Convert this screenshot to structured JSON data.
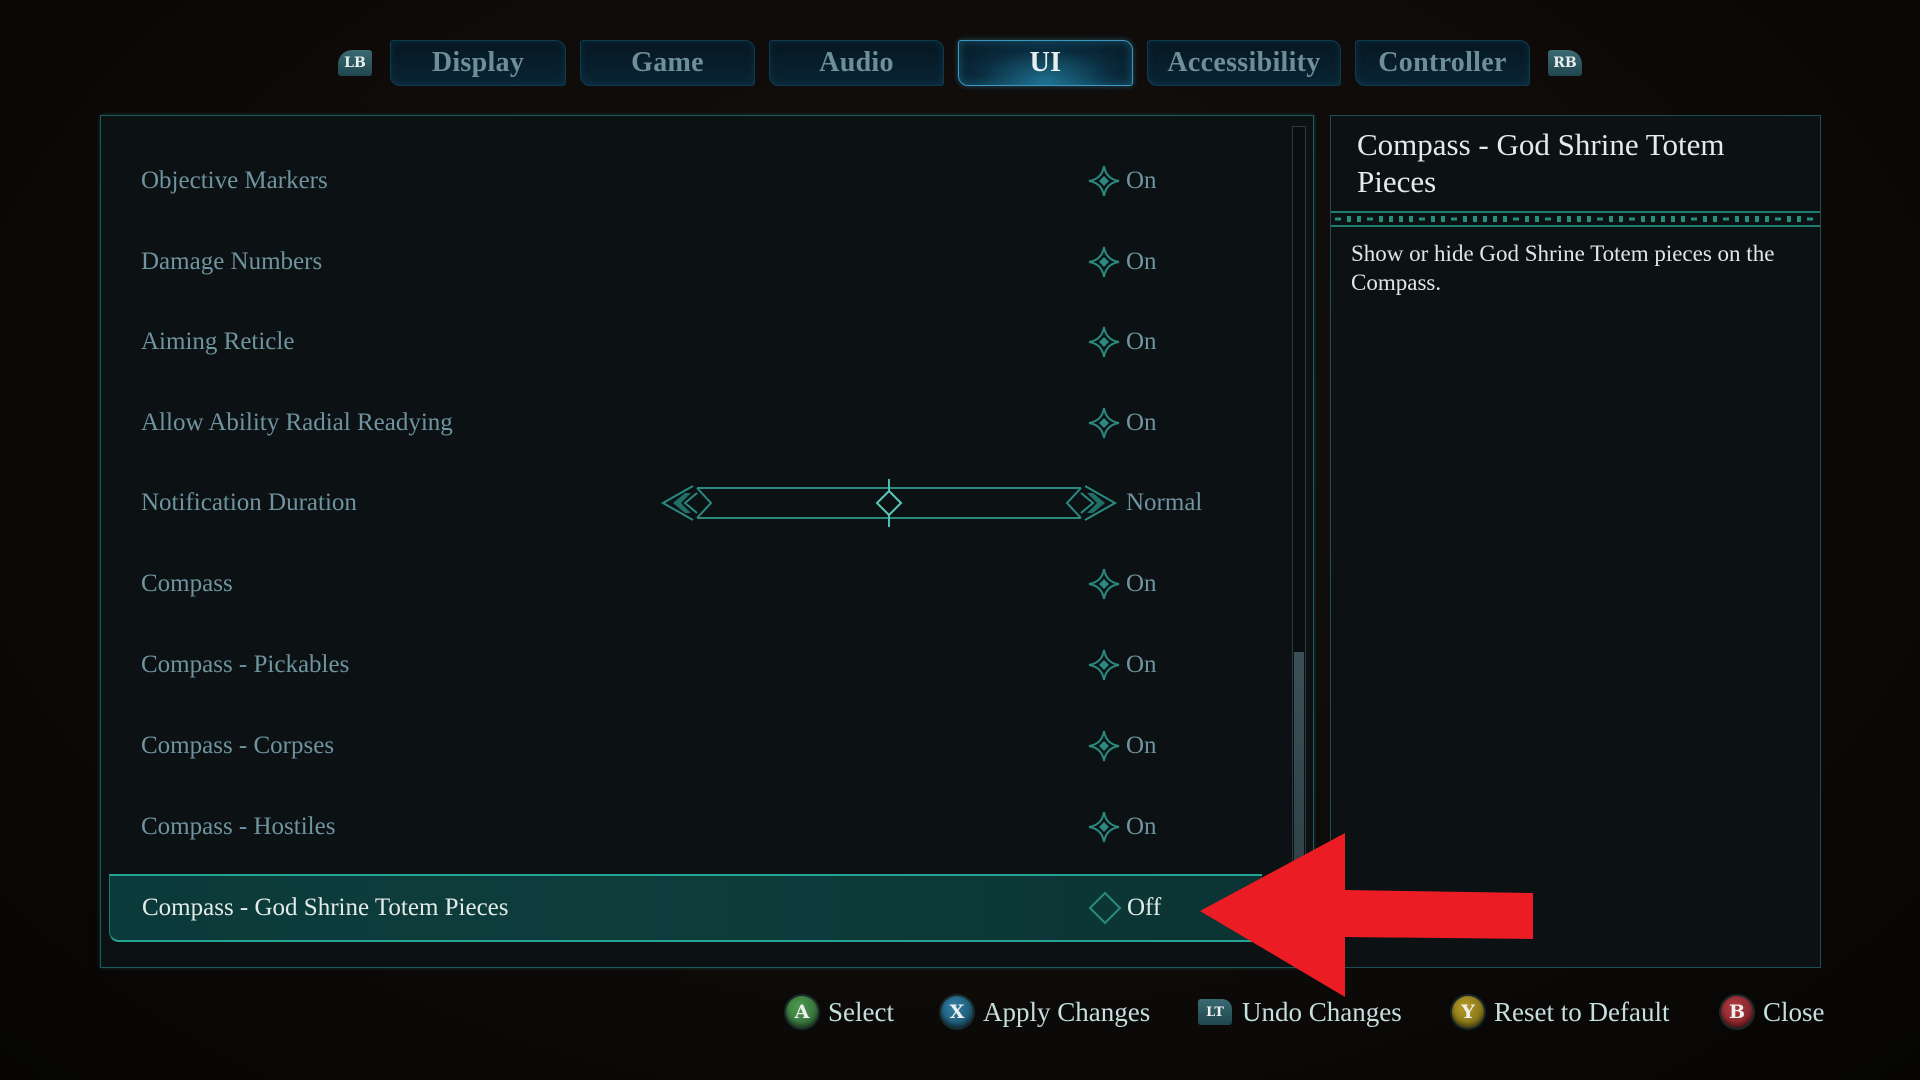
{
  "tabs": {
    "prev_bumper": "LB",
    "next_bumper": "RB",
    "items": [
      {
        "label": "Display",
        "active": false
      },
      {
        "label": "Game",
        "active": false
      },
      {
        "label": "Audio",
        "active": false
      },
      {
        "label": "UI",
        "active": true
      },
      {
        "label": "Accessibility",
        "active": false
      },
      {
        "label": "Controller",
        "active": false
      }
    ]
  },
  "settings": {
    "rows": [
      {
        "label": "Objective Markers",
        "type": "toggle",
        "value": "On"
      },
      {
        "label": "Damage Numbers",
        "type": "toggle",
        "value": "On"
      },
      {
        "label": "Aiming Reticle",
        "type": "toggle",
        "value": "On"
      },
      {
        "label": "Allow Ability Radial Readying",
        "type": "toggle",
        "value": "On"
      },
      {
        "label": "Notification Duration",
        "type": "slider",
        "value": "Normal",
        "slider_position": 0.5
      },
      {
        "label": "Compass",
        "type": "toggle",
        "value": "On"
      },
      {
        "label": "Compass - Pickables",
        "type": "toggle",
        "value": "On"
      },
      {
        "label": "Compass - Corpses",
        "type": "toggle",
        "value": "On"
      },
      {
        "label": "Compass - Hostiles",
        "type": "toggle",
        "value": "On"
      },
      {
        "label": "Compass - God Shrine Totem Pieces",
        "type": "toggle",
        "value": "Off",
        "selected": true
      }
    ],
    "scroll": {
      "thumb_start_fraction": 0.63,
      "thumb_end_fraction": 1.0
    }
  },
  "info_panel": {
    "title": "Compass - God Shrine Totem Pieces",
    "description": "Show or hide God Shrine Totem pieces on the Compass."
  },
  "footer": {
    "hints": [
      {
        "button": "A",
        "label": "Select"
      },
      {
        "button": "X",
        "label": "Apply Changes"
      },
      {
        "button": "LT",
        "label": "Undo Changes"
      },
      {
        "button": "Y",
        "label": "Reset to Default"
      },
      {
        "button": "B",
        "label": "Close"
      }
    ]
  },
  "colors": {
    "accent_teal": "#27a396",
    "active_tab_border": "#3b97bd",
    "annotation_red": "#ec1c24"
  }
}
